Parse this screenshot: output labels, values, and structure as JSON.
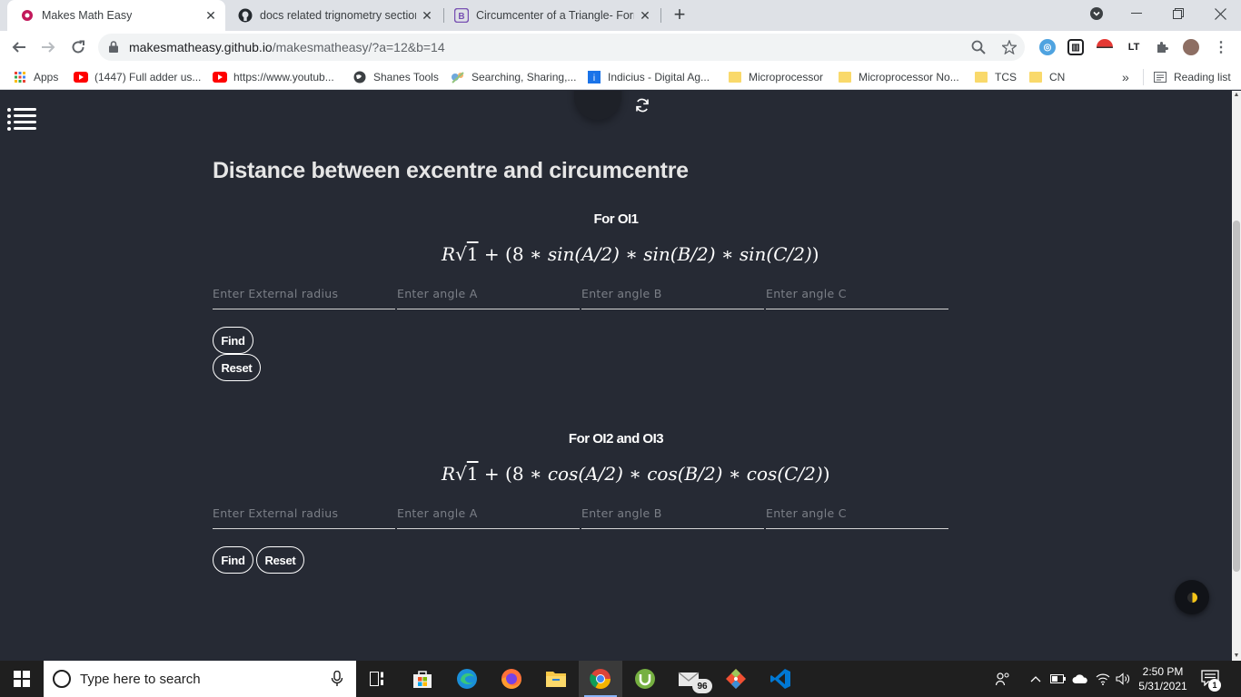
{
  "browser": {
    "tabs": [
      {
        "title": "Makes Math Easy",
        "active": true
      },
      {
        "title": "docs related trignometry section",
        "active": false
      },
      {
        "title": "Circumcenter of a Triangle- Form",
        "active": false
      }
    ],
    "address": {
      "host": "makesmatheasy.github.io",
      "path": "/makesmatheasy/?a=12&b=14"
    },
    "bookmarks": [
      {
        "label": "Apps",
        "icon": "apps-grid-icon"
      },
      {
        "label": "(1447) Full adder us...",
        "icon": "youtube-icon"
      },
      {
        "label": "https://www.youtub...",
        "icon": "youtube-icon"
      },
      {
        "label": "Shanes Tools",
        "icon": "globe-icon"
      },
      {
        "label": "Searching, Sharing,...",
        "icon": "site-icon"
      },
      {
        "label": "Indicius - Digital Ag...",
        "icon": "site-icon"
      },
      {
        "label": "Microprocessor",
        "icon": "folder-icon"
      },
      {
        "label": "Microprocessor No...",
        "icon": "folder-icon"
      },
      {
        "label": "TCS",
        "icon": "folder-icon"
      },
      {
        "label": "CN",
        "icon": "folder-icon"
      }
    ],
    "more_bookmarks": "»",
    "reading_list": "Reading list"
  },
  "page": {
    "heading": "Distance between excentre and circumcentre",
    "section1": {
      "title": "For OI1",
      "formula": {
        "coef": "R",
        "sqrt": "√",
        "one": "1",
        "plus": " + (8 ∗ ",
        "f1": "sin",
        "a1": "(A/2)",
        "m1": " ∗ ",
        "f2": "sin",
        "a2": "(B/2)",
        "m2": " ∗ ",
        "f3": "sin",
        "a3": "(C/2)",
        "close": ")"
      },
      "placeholders": {
        "radius": "Enter External radius",
        "angle_a": "Enter angle A",
        "angle_b": "Enter angle B",
        "angle_c": "Enter angle C"
      },
      "find_label": "Find",
      "reset_label": "Reset"
    },
    "section2": {
      "title": "For OI2 and OI3",
      "formula": {
        "coef": "R",
        "sqrt": "√",
        "one": "1",
        "plus": " + (8 ∗ ",
        "f1": "cos",
        "a1": "(A/2)",
        "m1": " ∗ ",
        "f2": "cos",
        "a2": "(B/2)",
        "m2": " ∗ ",
        "f3": "cos",
        "a3": "(C/2)",
        "close": ")"
      },
      "placeholders": {
        "radius": "Enter External radius",
        "angle_a": "Enter angle A",
        "angle_b": "Enter angle B",
        "angle_c": "Enter angle C"
      },
      "find_label": "Find",
      "reset_label": "Reset"
    }
  },
  "taskbar": {
    "search_placeholder": "Type here to search",
    "mail_badge": "96",
    "time": "2:50 PM",
    "date": "5/31/2021",
    "notification_count": "1"
  },
  "colors": {
    "page_bg": "#262a34",
    "tab_strip": "#dee1e6",
    "taskbar": "#1f1f1f"
  }
}
